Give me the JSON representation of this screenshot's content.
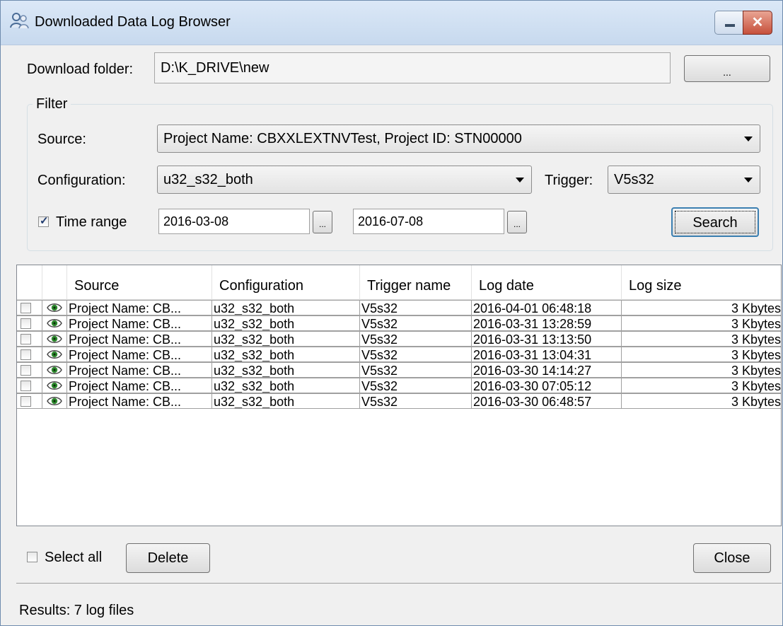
{
  "window": {
    "title": "Downloaded Data Log Browser"
  },
  "download_folder": {
    "label": "Download folder:",
    "value": "D:\\K_DRIVE\\new",
    "browse_label": "..."
  },
  "filter": {
    "title": "Filter",
    "source_label": "Source:",
    "source_value": "Project Name: CBXXLEXTNVTest, Project ID: STN00000",
    "configuration_label": "Configuration:",
    "configuration_value": "u32_s32_both",
    "trigger_label": "Trigger:",
    "trigger_value": "V5s32",
    "time_range_label": "Time range",
    "time_range_checked": true,
    "date_from": "2016-03-08",
    "date_to": "2016-07-08",
    "picker_label": "...",
    "search_label": "Search"
  },
  "table": {
    "columns": [
      "Source",
      "Configuration",
      "Trigger name",
      "Log date",
      "Log size"
    ],
    "rows": [
      {
        "source": "Project Name: CB...",
        "configuration": "u32_s32_both",
        "trigger": "V5s32",
        "date": "2016-04-01 06:48:18",
        "size": "3 Kbytes"
      },
      {
        "source": "Project Name: CB...",
        "configuration": "u32_s32_both",
        "trigger": "V5s32",
        "date": "2016-03-31 13:28:59",
        "size": "3 Kbytes"
      },
      {
        "source": "Project Name: CB...",
        "configuration": "u32_s32_both",
        "trigger": "V5s32",
        "date": "2016-03-31 13:13:50",
        "size": "3 Kbytes"
      },
      {
        "source": "Project Name: CB...",
        "configuration": "u32_s32_both",
        "trigger": "V5s32",
        "date": "2016-03-31 13:04:31",
        "size": "3 Kbytes"
      },
      {
        "source": "Project Name: CB...",
        "configuration": "u32_s32_both",
        "trigger": "V5s32",
        "date": "2016-03-30 14:14:27",
        "size": "3 Kbytes"
      },
      {
        "source": "Project Name: CB...",
        "configuration": "u32_s32_both",
        "trigger": "V5s32",
        "date": "2016-03-30 07:05:12",
        "size": "3 Kbytes"
      },
      {
        "source": "Project Name: CB...",
        "configuration": "u32_s32_both",
        "trigger": "V5s32",
        "date": "2016-03-30 06:48:57",
        "size": "3 Kbytes"
      }
    ]
  },
  "footer": {
    "select_all_label": "Select all",
    "delete_label": "Delete",
    "close_label": "Close"
  },
  "status": {
    "text": "Results: 7 log files"
  },
  "colors": {
    "titlebar": "#c7d9ee",
    "close_button": "#c6503b",
    "eye_icon": "#2e8b2e"
  }
}
